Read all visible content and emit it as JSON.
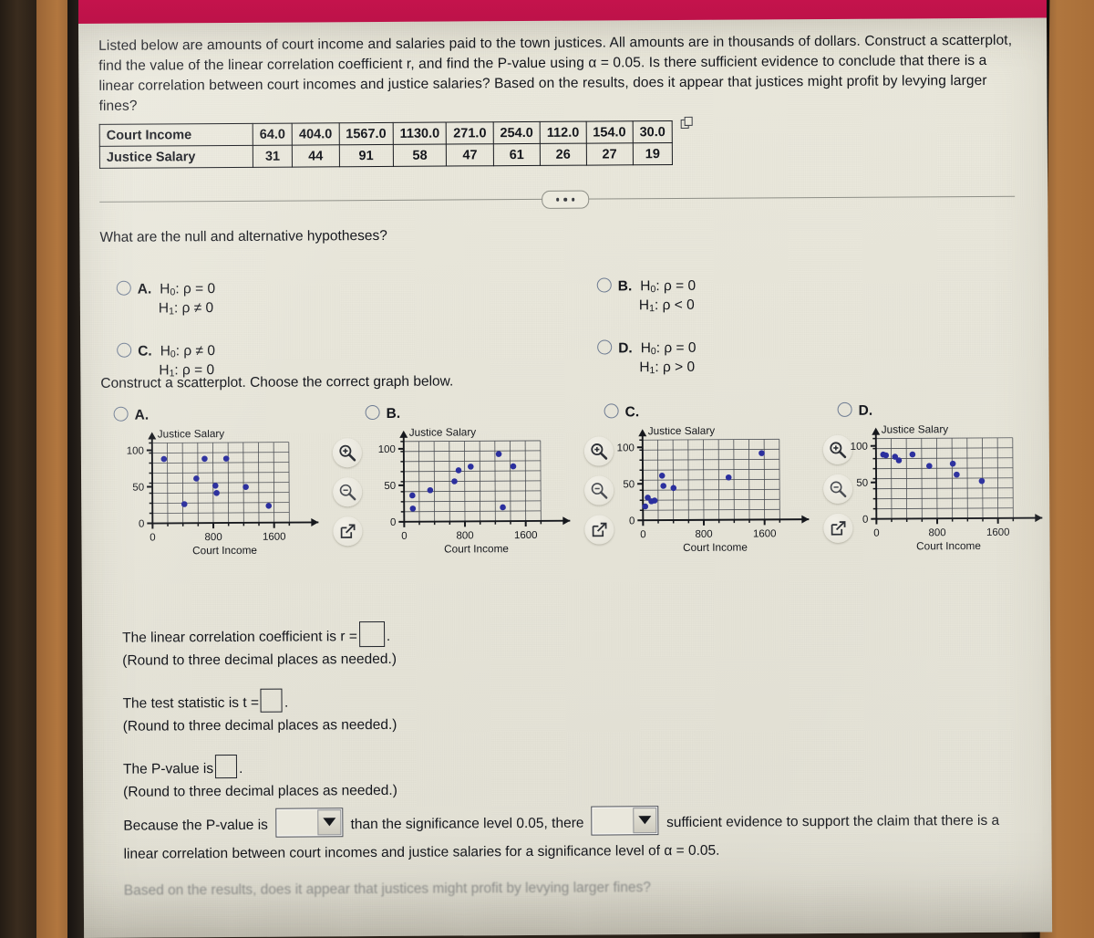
{
  "app": {
    "header_color": "#c4134c",
    "page_bg": "#eceade",
    "point_color": "#2b2f9e"
  },
  "prompt": {
    "text": "Listed below are amounts of court income and salaries paid to the town justices. All amounts are in thousands of dollars. Construct a scatterplot, find the value of the linear correlation coefficient r, and find the P-value using α = 0.05. Is there sufficient evidence to conclude that there is a linear correlation between court incomes and justice salaries? Based on the results, does it appear that justices might profit by levying larger fines?"
  },
  "data_table": {
    "rows": [
      {
        "label": "Court Income",
        "values": [
          "64.0",
          "404.0",
          "1567.0",
          "1130.0",
          "271.0",
          "254.0",
          "112.0",
          "154.0",
          "30.0"
        ]
      },
      {
        "label": "Justice Salary",
        "values": [
          "31",
          "44",
          "91",
          "58",
          "47",
          "61",
          "26",
          "27",
          "19"
        ]
      }
    ],
    "copy_icon": "copy-icon"
  },
  "divider": {
    "ellipsis": "•••"
  },
  "hypothesis": {
    "question": "What are the null and alternative hypotheses?",
    "options": [
      {
        "letter": "A.",
        "h0_sub": "0",
        "h0": "ρ = 0",
        "h1_sub": "1",
        "h1": "ρ ≠ 0"
      },
      {
        "letter": "B.",
        "h0_sub": "0",
        "h0": "ρ = 0",
        "h1_sub": "1",
        "h1": "ρ < 0"
      },
      {
        "letter": "C.",
        "h0_sub": "0",
        "h0": "ρ ≠ 0",
        "h1_sub": "1",
        "h1": "ρ = 0"
      },
      {
        "letter": "D.",
        "h0_sub": "0",
        "h0": "ρ = 0",
        "h1_sub": "1",
        "h1": "ρ > 0"
      }
    ],
    "h_label_0": "H",
    "h_label_1": "H"
  },
  "scatter_section": {
    "instruction": "Construct a scatterplot. Choose the correct graph below.",
    "tools": [
      "zoom-in-icon",
      "zoom-out-icon",
      "open-popup-icon"
    ]
  },
  "chart_data": [
    {
      "id": "A",
      "type": "scatter",
      "title": "",
      "xlabel": "Court Income",
      "ylabel": "Justice Salary",
      "xlim": [
        0,
        1800
      ],
      "ylim": [
        0,
        110
      ],
      "xticks": [
        0,
        800,
        1600
      ],
      "yticks": [
        0,
        50,
        100
      ],
      "grid": true,
      "points": [
        {
          "x": 155,
          "y": 88
        },
        {
          "x": 690,
          "y": 88
        },
        {
          "x": 975,
          "y": 88
        },
        {
          "x": 580,
          "y": 61
        },
        {
          "x": 830,
          "y": 51
        },
        {
          "x": 1230,
          "y": 49
        },
        {
          "x": 845,
          "y": 41
        },
        {
          "x": 420,
          "y": 26
        },
        {
          "x": 1530,
          "y": 23
        }
      ]
    },
    {
      "id": "B",
      "type": "scatter",
      "title": "",
      "xlabel": "Court Income",
      "ylabel": "Justice Salary",
      "xlim": [
        0,
        1800
      ],
      "ylim": [
        0,
        110
      ],
      "xticks": [
        0,
        800,
        1600
      ],
      "yticks": [
        0,
        50,
        100
      ],
      "grid": true,
      "points": [
        {
          "x": 115,
          "y": 18
        },
        {
          "x": 110,
          "y": 36
        },
        {
          "x": 345,
          "y": 43
        },
        {
          "x": 665,
          "y": 55
        },
        {
          "x": 720,
          "y": 70
        },
        {
          "x": 880,
          "y": 75
        },
        {
          "x": 1250,
          "y": 92
        },
        {
          "x": 1440,
          "y": 75
        },
        {
          "x": 1300,
          "y": 19
        }
      ]
    },
    {
      "id": "C",
      "type": "scatter",
      "title": "",
      "xlabel": "Court Income",
      "ylabel": "Justice Salary",
      "xlim": [
        0,
        1800
      ],
      "ylim": [
        0,
        110
      ],
      "xticks": [
        0,
        800,
        1600
      ],
      "yticks": [
        0,
        50,
        100
      ],
      "grid": true,
      "points": [
        {
          "x": 30,
          "y": 19
        },
        {
          "x": 64,
          "y": 31
        },
        {
          "x": 112,
          "y": 26
        },
        {
          "x": 154,
          "y": 27
        },
        {
          "x": 254,
          "y": 61
        },
        {
          "x": 271,
          "y": 47
        },
        {
          "x": 404,
          "y": 44
        },
        {
          "x": 1130,
          "y": 58
        },
        {
          "x": 1567,
          "y": 91
        }
      ]
    },
    {
      "id": "D",
      "type": "scatter",
      "title": "",
      "xlabel": "Court Income",
      "ylabel": "Justice Salary",
      "xlim": [
        0,
        1800
      ],
      "ylim": [
        0,
        110
      ],
      "xticks": [
        0,
        800,
        1600
      ],
      "yticks": [
        0,
        50,
        100
      ],
      "grid": true,
      "points": [
        {
          "x": 95,
          "y": 88
        },
        {
          "x": 130,
          "y": 87
        },
        {
          "x": 250,
          "y": 85
        },
        {
          "x": 300,
          "y": 80
        },
        {
          "x": 480,
          "y": 88
        },
        {
          "x": 700,
          "y": 72
        },
        {
          "x": 1010,
          "y": 75
        },
        {
          "x": 1060,
          "y": 60
        },
        {
          "x": 1390,
          "y": 51
        }
      ]
    }
  ],
  "answers": {
    "r_text_before": "The linear correlation coefficient is r =",
    "r_text_after": ".",
    "r_note": "(Round to three decimal places as needed.)",
    "t_text_before": "The test statistic is t =",
    "t_text_after": ".",
    "t_note": "(Round to three decimal places as needed.)",
    "p_text_before": "The P-value is",
    "p_text_after": ".",
    "p_note": "(Round to three decimal places as needed.)"
  },
  "conclusion": {
    "part1": "Because the P-value is",
    "part2": "than the significance level 0.05, there",
    "part3": "sufficient evidence to support the claim that there is a linear correlation between court incomes and justice salaries for a significance level of α = 0.05.",
    "dropdown1_value": "",
    "dropdown2_value": ""
  },
  "trailing": {
    "text": "Based on the results, does it appear that justices might profit by levying larger fines?"
  }
}
